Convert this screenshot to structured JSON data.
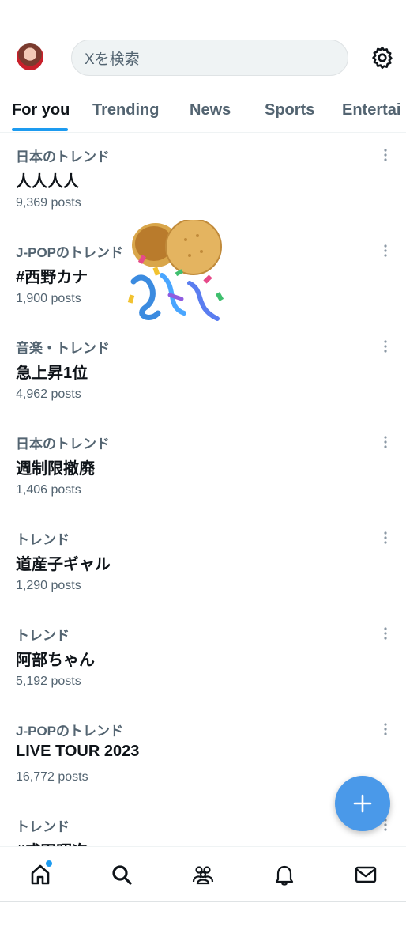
{
  "header": {
    "search_placeholder": "Xを検索"
  },
  "tabs": [
    {
      "label": "For you"
    },
    {
      "label": "Trending"
    },
    {
      "label": "News"
    },
    {
      "label": "Sports"
    },
    {
      "label": "Entertai"
    }
  ],
  "trends": [
    {
      "category": "日本のトレンド",
      "title": "人人人人",
      "posts": "9,369 posts"
    },
    {
      "category": "J-POPのトレンド",
      "title": "#西野カナ",
      "posts": "1,900 posts"
    },
    {
      "category": "音楽・トレンド",
      "title": "急上昇1位",
      "posts": "4,962 posts"
    },
    {
      "category": "日本のトレンド",
      "title": "週制限撤廃",
      "posts": "1,406 posts"
    },
    {
      "category": "トレンド",
      "title": "道産子ギャル",
      "posts": "1,290 posts"
    },
    {
      "category": "トレンド",
      "title": "阿部ちゃん",
      "posts": "5,192 posts"
    },
    {
      "category": "J-POPのトレンド",
      "title": "LIVE TOUR 2023",
      "posts": "16,772 posts"
    },
    {
      "category": "トレンド",
      "title": "#成田昭次",
      "posts": ""
    }
  ],
  "colors": {
    "accent": "#1d9bf0",
    "fab": "#4a99e9",
    "secondary_text": "#536471"
  },
  "icons": {
    "settings": "gear-icon",
    "more": "more-vertical-icon",
    "compose": "plus-icon",
    "nav": [
      "home-icon",
      "search-icon",
      "communities-icon",
      "notifications-icon",
      "messages-icon"
    ]
  }
}
